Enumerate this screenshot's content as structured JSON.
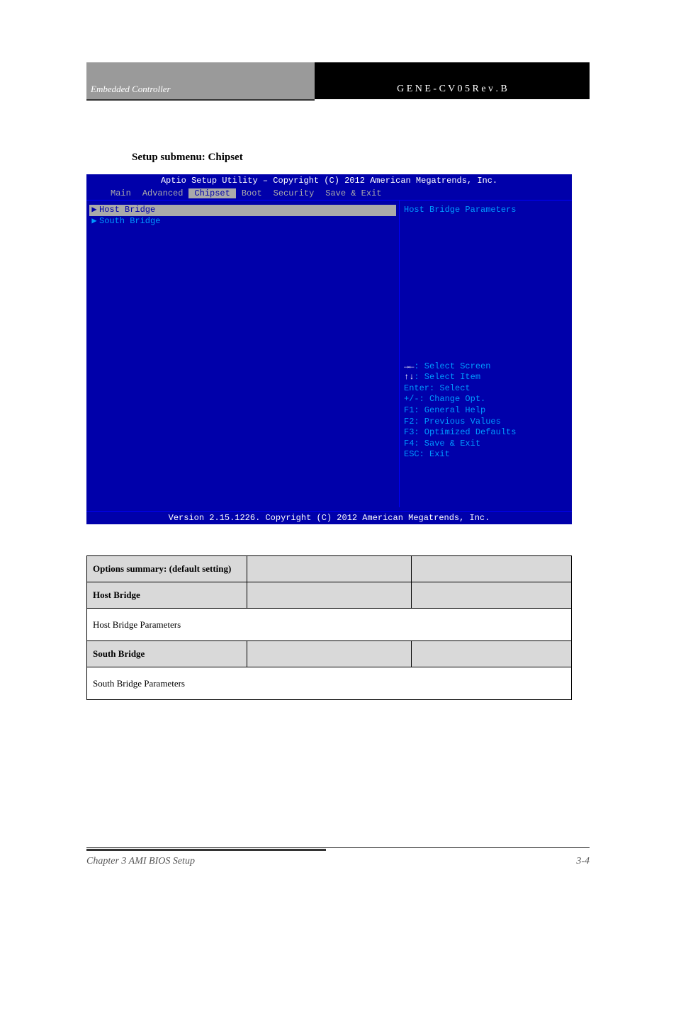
{
  "doc_header": {
    "left": "Embedded Controller",
    "right": "G E N E - C V 0 5   R e v . B"
  },
  "breadcrumb": "",
  "section_heading": "Setup submenu: Chipset",
  "bios": {
    "title": "Aptio Setup Utility – Copyright (C) 2012 American Megatrends, Inc.",
    "menu": [
      "Main",
      "Advanced",
      "Chipset",
      "Boot",
      "Security",
      "Save & Exit"
    ],
    "selected_menu_index": 2,
    "items": [
      "Host Bridge",
      "South Bridge"
    ],
    "selected_item_index": 0,
    "help_description": "Host Bridge Parameters",
    "help_keys": [
      {
        "k": "→←",
        "t": ": Select Screen"
      },
      {
        "k": "↑↓",
        "t": ": Select Item"
      },
      {
        "k": "",
        "t": "Enter: Select"
      },
      {
        "k": "",
        "t": "+/-: Change Opt."
      },
      {
        "k": "",
        "t": "F1: General Help"
      },
      {
        "k": "",
        "t": "F2: Previous Values"
      },
      {
        "k": "",
        "t": "F3: Optimized Defaults"
      },
      {
        "k": "",
        "t": "F4: Save & Exit"
      },
      {
        "k": "",
        "t": "ESC: Exit"
      }
    ],
    "footer": "Version 2.15.1226. Copyright (C) 2012 American Megatrends, Inc."
  },
  "table": {
    "headers": [
      "Options summary: (default setting)",
      "",
      ""
    ],
    "rows": [
      {
        "h": [
          "Host Bridge",
          "",
          ""
        ],
        "d": "Host Bridge Parameters"
      },
      {
        "h": [
          "South Bridge",
          "",
          ""
        ],
        "d": "South Bridge Parameters"
      }
    ]
  },
  "footer": {
    "left": "Chapter 3 AMI BIOS Setup",
    "right": "3-4"
  }
}
